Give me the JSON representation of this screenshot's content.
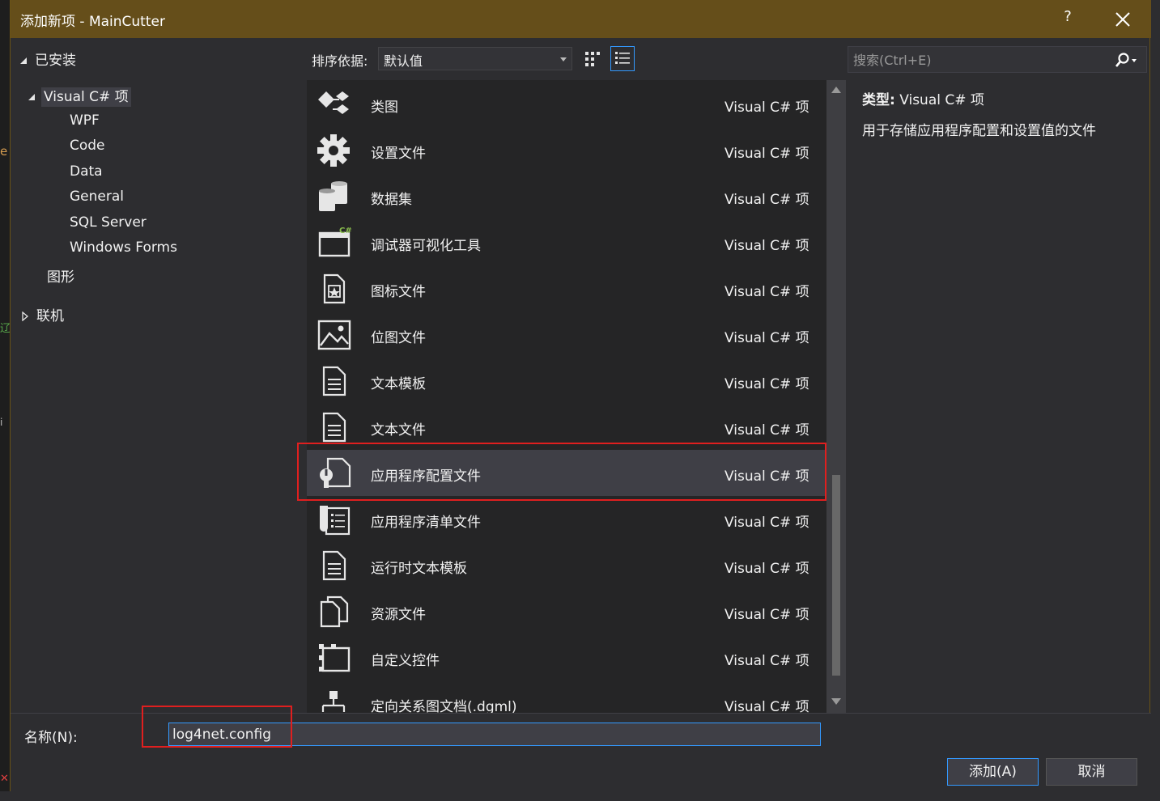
{
  "window": {
    "title": "添加新项 - MainCutter",
    "help_label": "?"
  },
  "tree": {
    "installed": "已安装",
    "visual_csharp": "Visual C# 项",
    "children": [
      "WPF",
      "Code",
      "Data",
      "General",
      "SQL Server",
      "Windows Forms"
    ],
    "graphics": "图形",
    "online": "联机"
  },
  "toolbar": {
    "sort_label": "排序依据:",
    "sort_value": "默认值"
  },
  "search": {
    "placeholder": "搜索(Ctrl+E)"
  },
  "items": [
    {
      "name": "类图",
      "type": "Visual C# 项",
      "icon": "class-diagram-icon"
    },
    {
      "name": "设置文件",
      "type": "Visual C# 项",
      "icon": "gear-icon"
    },
    {
      "name": "数据集",
      "type": "Visual C# 项",
      "icon": "dataset-icon"
    },
    {
      "name": "调试器可视化工具",
      "type": "Visual C# 项",
      "icon": "debugger-visualizer-icon"
    },
    {
      "name": "图标文件",
      "type": "Visual C# 项",
      "icon": "icon-file-icon"
    },
    {
      "name": "位图文件",
      "type": "Visual C# 项",
      "icon": "bitmap-icon"
    },
    {
      "name": "文本模板",
      "type": "Visual C# 项",
      "icon": "text-template-icon"
    },
    {
      "name": "文本文件",
      "type": "Visual C# 项",
      "icon": "text-file-icon"
    },
    {
      "name": "应用程序配置文件",
      "type": "Visual C# 项",
      "icon": "config-file-icon",
      "selected": true
    },
    {
      "name": "应用程序清单文件",
      "type": "Visual C# 项",
      "icon": "manifest-icon"
    },
    {
      "name": "运行时文本模板",
      "type": "Visual C# 项",
      "icon": "runtime-template-icon"
    },
    {
      "name": "资源文件",
      "type": "Visual C# 项",
      "icon": "resource-file-icon"
    },
    {
      "name": "自定义控件",
      "type": "Visual C# 项",
      "icon": "custom-control-icon"
    },
    {
      "name": "定向关系图文档(.dgml)",
      "type": "Visual C# 项",
      "icon": "dgml-icon"
    }
  ],
  "details": {
    "type_label": "类型:",
    "type_value": "Visual C# 项",
    "description": "用于存储应用程序配置和设置值的文件"
  },
  "bottom": {
    "name_label": "名称(N):",
    "name_value": "log4net.config",
    "add_button": "添加(A)",
    "cancel_button": "取消"
  },
  "colors": {
    "titlebar": "#654e1a",
    "highlight": "#e01f1f",
    "accent": "#3399ff"
  }
}
